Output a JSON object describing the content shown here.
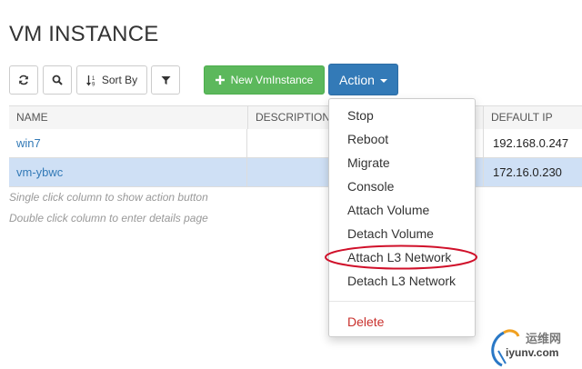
{
  "page": {
    "title": "VM INSTANCE"
  },
  "toolbar": {
    "refresh_icon": "refresh-icon",
    "search_icon": "search-icon",
    "sort_label": "Sort By",
    "sort_icon": "sort-numeric-icon",
    "filter_icon": "filter-icon",
    "new_label": "New VmInstance",
    "new_icon": "plus-icon",
    "action_label": "Action",
    "colors": {
      "new_button": "#5cb85c",
      "action_button": "#337ab7"
    }
  },
  "table": {
    "columns": [
      "NAME",
      "DESCRIPTION",
      "DEFAULT IP"
    ],
    "rows": [
      {
        "name": "win7",
        "description": "",
        "default_ip": "192.168.0.247",
        "selected": false
      },
      {
        "name": "vm-ybwc",
        "description": "",
        "default_ip": "172.16.0.230",
        "selected": true
      }
    ],
    "selected_row_color": "#cfe0f5"
  },
  "hints": {
    "single_click": "Single click column to show action button",
    "double_click": "Double click column to enter details page"
  },
  "action_menu": {
    "items": [
      "Stop",
      "Reboot",
      "Migrate",
      "Console",
      "Attach Volume",
      "Detach Volume",
      "Attach L3 Network",
      "Detach L3 Network"
    ],
    "danger_item": "Delete",
    "highlighted_item": "Attach L3 Network",
    "danger_color": "#c9302c",
    "highlight_color": "#d0102a"
  },
  "watermark": {
    "cn": "运维网",
    "url": "iyunv.com"
  }
}
